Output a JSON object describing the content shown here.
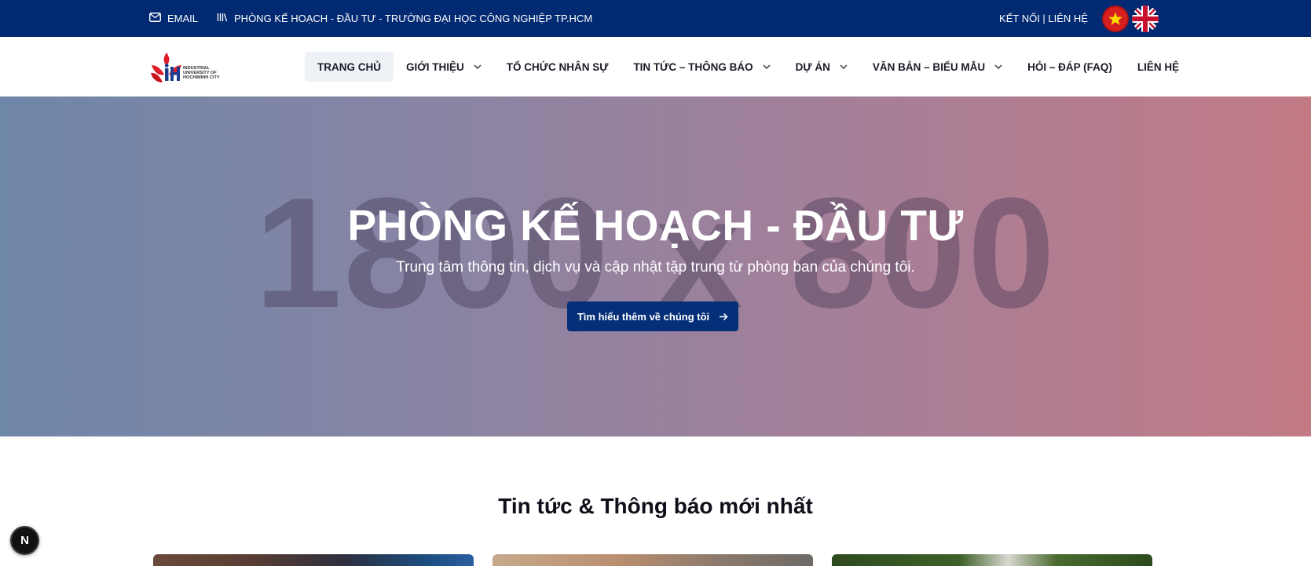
{
  "topbar": {
    "email_label": "EMAIL",
    "department_label": "PHÒNG KẾ HOẠCH - ĐẦU TƯ - TRƯỜNG ĐẠI HỌC CÔNG NGHIỆP TP.HCM",
    "connect_label": "KẾT NỐI | LIÊN HỆ",
    "icons": [
      "mail-icon",
      "library-icon",
      "vietnam-flag-icon",
      "uk-flag-icon"
    ],
    "color": "#022a72"
  },
  "logo": {
    "lines": [
      "INDUSTRIAL",
      "UNIVERSITY OF",
      "HOCHIMINH CITY"
    ],
    "mark": "IUH"
  },
  "nav": {
    "items": [
      {
        "label": "TRANG CHỦ",
        "active": true,
        "dropdown": false
      },
      {
        "label": "GIỚI THIỆU",
        "active": false,
        "dropdown": true
      },
      {
        "label": "TỔ CHỨC NHÂN SỰ",
        "active": false,
        "dropdown": false
      },
      {
        "label": "TIN TỨC – THÔNG BÁO",
        "active": false,
        "dropdown": true
      },
      {
        "label": "DỰ ÁN",
        "active": false,
        "dropdown": true
      },
      {
        "label": "VĂN BẢN – BIỂU MẪU",
        "active": false,
        "dropdown": true
      },
      {
        "label": "HỎI – ĐÁP (FAQ)",
        "active": false,
        "dropdown": false
      },
      {
        "label": "LIÊN HỆ",
        "active": false,
        "dropdown": false
      }
    ]
  },
  "hero": {
    "placeholder": "1800 x 800",
    "title": "PHÒNG KẾ HOẠCH - ĐẦU TƯ",
    "subtitle": "Trung tâm thông tin, dịch vụ và cập nhật tập trung từ phòng ban của chúng tôi.",
    "button_label": "Tìm hiểu thêm về chúng tôi",
    "button_color": "#052f78"
  },
  "news": {
    "title": "Tin tức & Thông báo mới nhất"
  },
  "badge": {
    "label": "N"
  }
}
